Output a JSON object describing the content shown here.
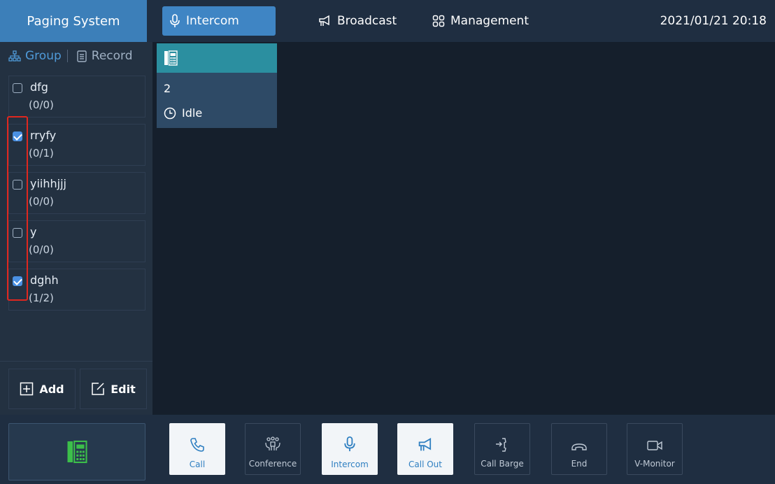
{
  "topbar": {
    "app_title": "Paging System",
    "tabs": [
      {
        "label": "Intercom",
        "icon": "mic-icon",
        "active": true
      },
      {
        "label": "Broadcast",
        "icon": "megaphone-icon",
        "active": false
      },
      {
        "label": "Management",
        "icon": "grid-icon",
        "active": false
      }
    ],
    "datetime": "2021/01/21 20:18"
  },
  "sidebar": {
    "tabs": [
      {
        "label": "Group",
        "icon": "org-chart-icon",
        "active": true
      },
      {
        "label": "Record",
        "icon": "clipboard-icon",
        "active": false
      }
    ],
    "groups": [
      {
        "name": "dfg",
        "count": "(0/0)",
        "checked": false
      },
      {
        "name": "rryfy",
        "count": "(0/1)",
        "checked": true
      },
      {
        "name": "yiihhjjj",
        "count": "(0/0)",
        "checked": false
      },
      {
        "name": "y",
        "count": "(0/0)",
        "checked": false
      },
      {
        "name": "dghh",
        "count": "(1/2)",
        "checked": true
      }
    ],
    "add_label": "Add",
    "edit_label": "Edit"
  },
  "main": {
    "device": {
      "number": "2",
      "status": "Idle",
      "icon": "desk-phone-icon"
    }
  },
  "bottombar": {
    "actions": [
      {
        "label": "Call",
        "icon": "phone-icon",
        "enabled": true
      },
      {
        "label": "Conference",
        "icon": "conference-icon",
        "enabled": false
      },
      {
        "label": "Intercom",
        "icon": "mic-icon",
        "enabled": true
      },
      {
        "label": "Call Out",
        "icon": "megaphone-icon",
        "enabled": true
      },
      {
        "label": "Call Barge",
        "icon": "call-barge-icon",
        "enabled": false
      },
      {
        "label": "End",
        "icon": "hang-up-icon",
        "enabled": false
      },
      {
        "label": "V-Monitor",
        "icon": "video-camera-icon",
        "enabled": false
      }
    ]
  },
  "colors": {
    "accent": "#3f85c4",
    "highlight": "#e0271f",
    "device_head": "#2b8fa0",
    "phone_green": "#3cbf4a"
  }
}
